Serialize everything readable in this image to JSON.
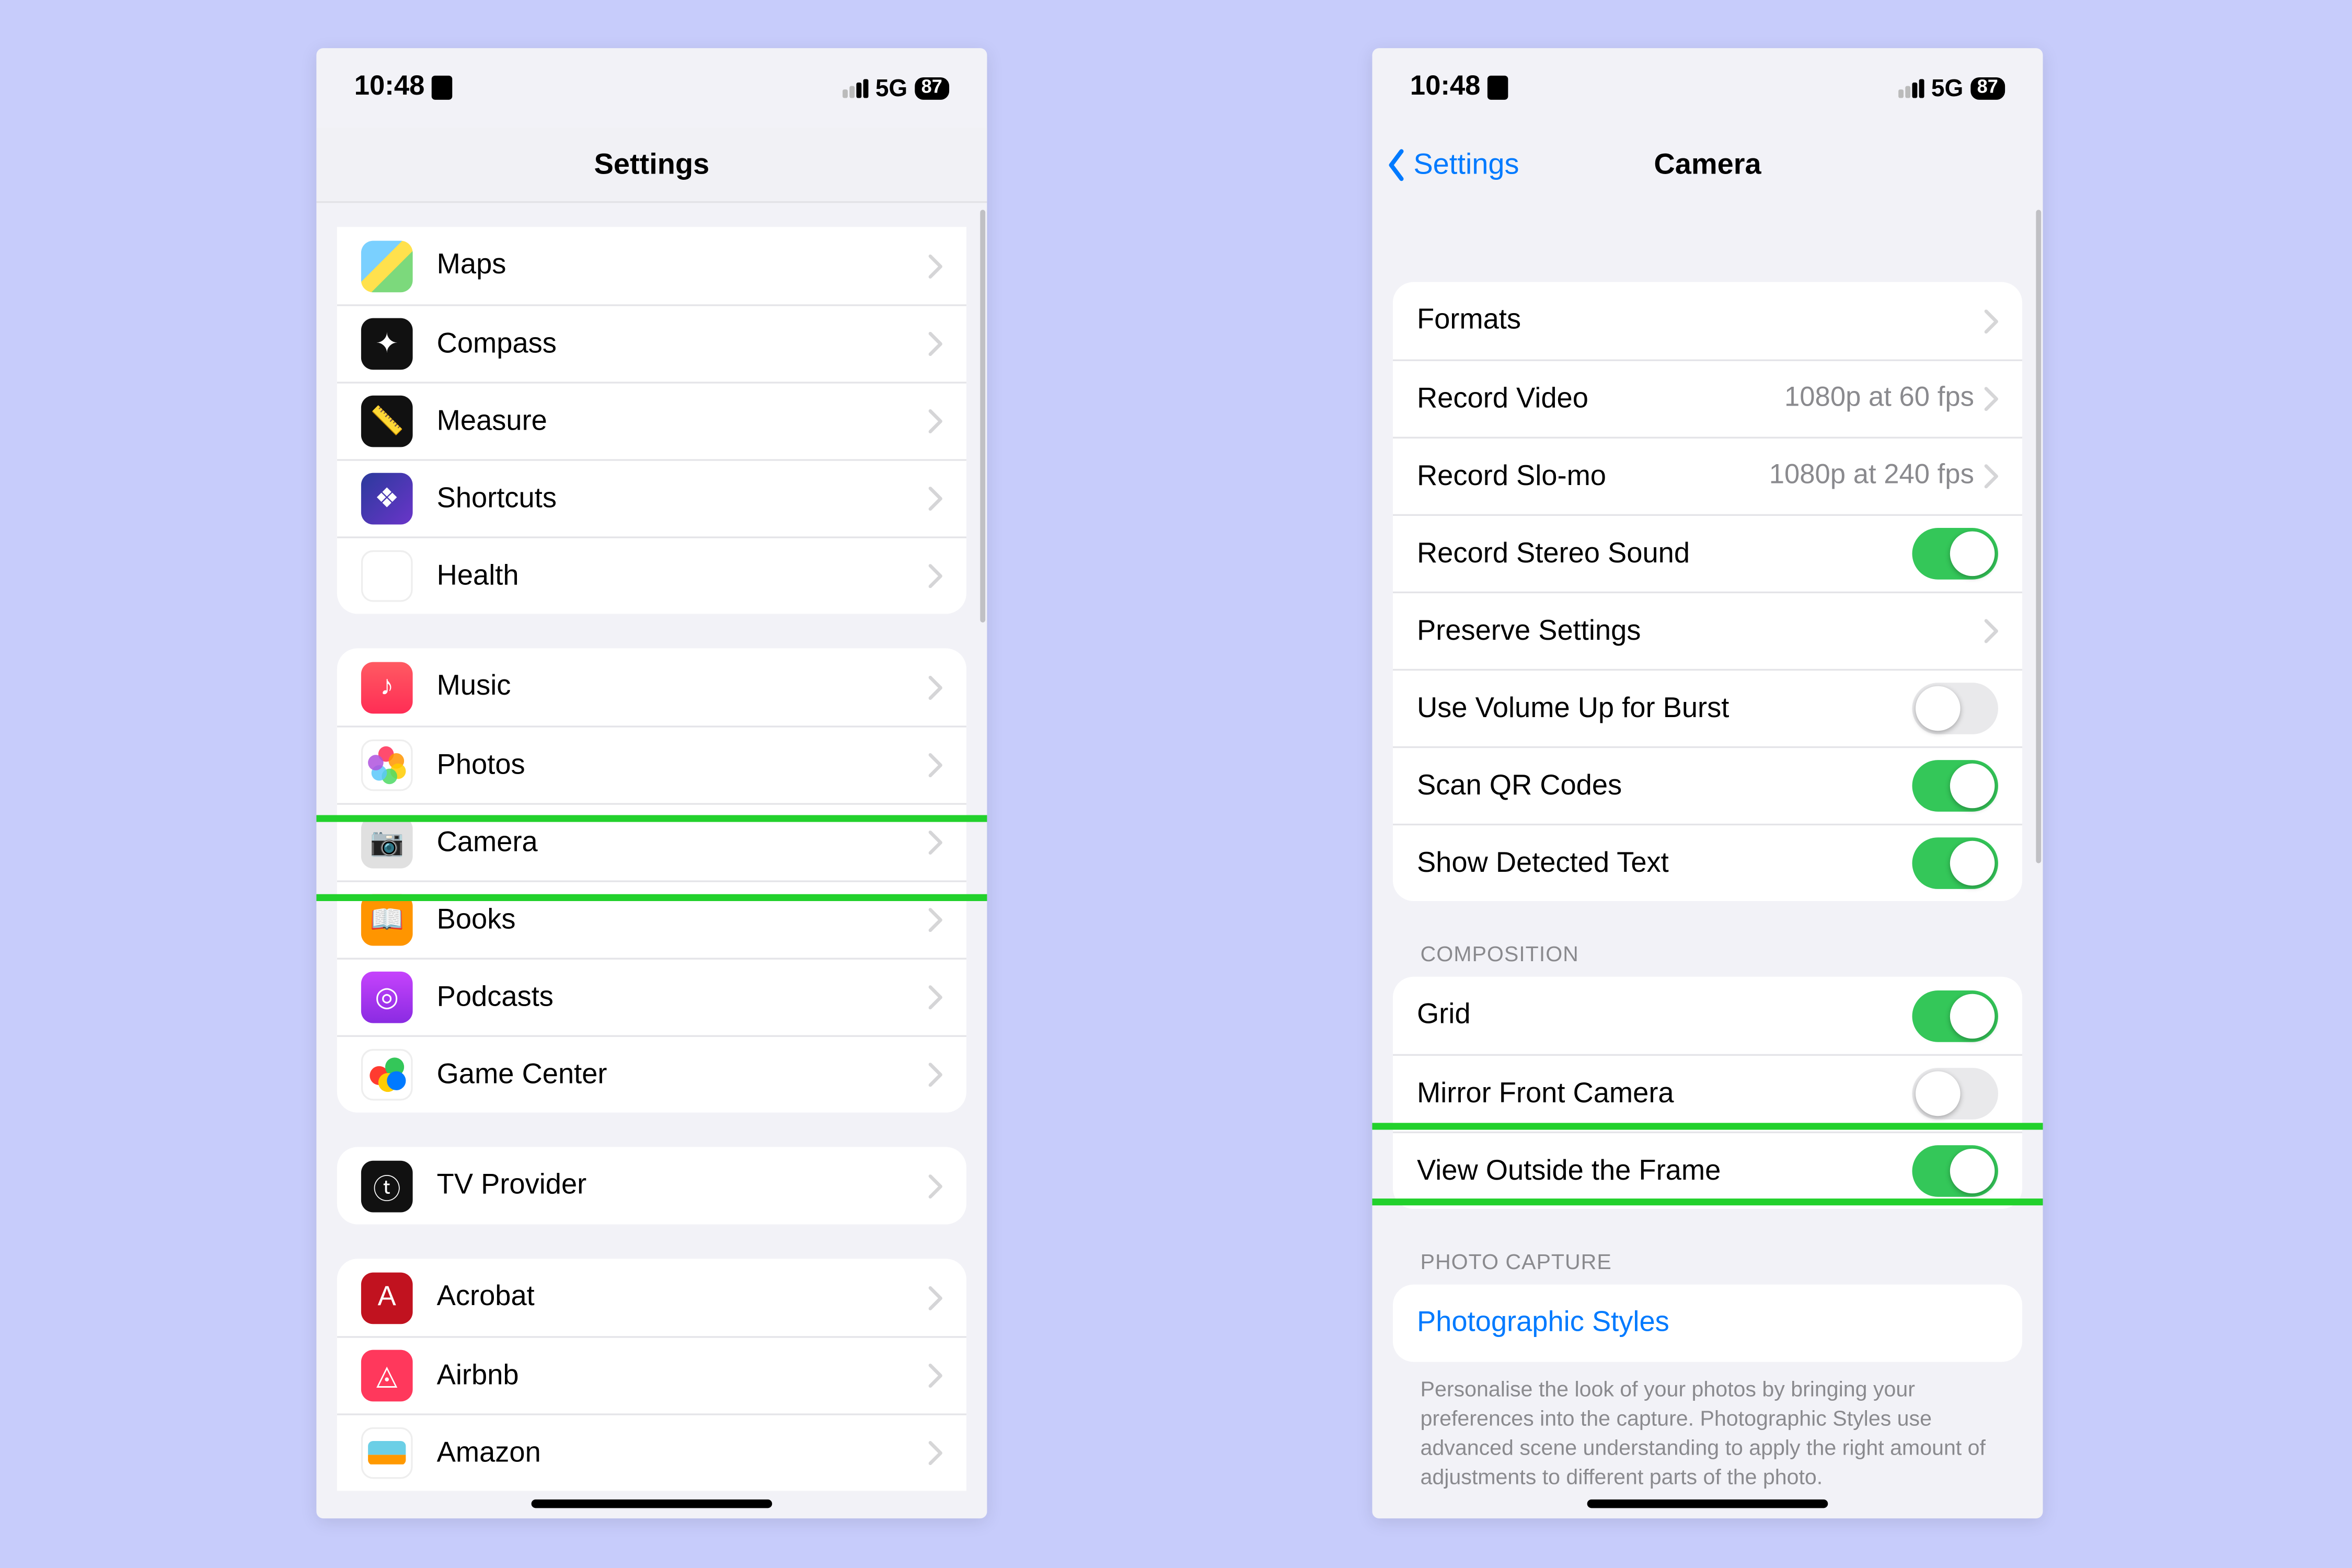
{
  "status": {
    "time": "10:48",
    "network": "5G",
    "battery": "87"
  },
  "left": {
    "title": "Settings",
    "g1": [
      {
        "name": "maps",
        "label": "Maps",
        "iconClass": "ic-maps",
        "glyph": ""
      },
      {
        "name": "compass",
        "label": "Compass",
        "iconClass": "ic-compass",
        "glyph": "✦"
      },
      {
        "name": "measure",
        "label": "Measure",
        "iconClass": "ic-measure",
        "glyph": "📏"
      },
      {
        "name": "shortcuts",
        "label": "Shortcuts",
        "iconClass": "ic-shortcuts",
        "glyph": "❖"
      },
      {
        "name": "health",
        "label": "Health",
        "iconClass": "ic-health",
        "glyph": "♥"
      }
    ],
    "g2": [
      {
        "name": "music",
        "label": "Music",
        "iconClass": "ic-music",
        "glyph": "♪"
      },
      {
        "name": "photos",
        "label": "Photos",
        "iconClass": "ic-photos",
        "glyph": ""
      },
      {
        "name": "camera",
        "label": "Camera",
        "iconClass": "ic-camera",
        "glyph": "📷"
      },
      {
        "name": "books",
        "label": "Books",
        "iconClass": "ic-books",
        "glyph": "📖"
      },
      {
        "name": "podcasts",
        "label": "Podcasts",
        "iconClass": "ic-podcasts",
        "glyph": "◎"
      },
      {
        "name": "game-center",
        "label": "Game Center",
        "iconClass": "ic-gamecenter",
        "glyph": ""
      }
    ],
    "g3": [
      {
        "name": "tv-provider",
        "label": "TV Provider",
        "iconClass": "ic-tv",
        "glyph": "ⓣ"
      }
    ],
    "g4": [
      {
        "name": "acrobat",
        "label": "Acrobat",
        "iconClass": "ic-acrobat",
        "glyph": "A"
      },
      {
        "name": "airbnb",
        "label": "Airbnb",
        "iconClass": "ic-airbnb",
        "glyph": "◬"
      },
      {
        "name": "amazon",
        "label": "Amazon",
        "iconClass": "ic-amazon",
        "glyph": ""
      }
    ]
  },
  "right": {
    "back": "Settings",
    "title": "Camera",
    "g1": [
      {
        "name": "formats",
        "label": "Formats",
        "type": "disclosure"
      },
      {
        "name": "record-video",
        "label": "Record Video",
        "type": "disclosure",
        "detail": "1080p at 60 fps"
      },
      {
        "name": "record-slomo",
        "label": "Record Slo-mo",
        "type": "disclosure",
        "detail": "1080p at 240 fps"
      },
      {
        "name": "record-stereo",
        "label": "Record Stereo Sound",
        "type": "toggle",
        "on": true
      },
      {
        "name": "preserve-settings",
        "label": "Preserve Settings",
        "type": "disclosure"
      },
      {
        "name": "volume-burst",
        "label": "Use Volume Up for Burst",
        "type": "toggle",
        "on": false
      },
      {
        "name": "scan-qr",
        "label": "Scan QR Codes",
        "type": "toggle",
        "on": true
      },
      {
        "name": "detected-text",
        "label": "Show Detected Text",
        "type": "toggle",
        "on": true
      }
    ],
    "h2": "Composition",
    "g2": [
      {
        "name": "grid",
        "label": "Grid",
        "type": "toggle",
        "on": true
      },
      {
        "name": "mirror-front",
        "label": "Mirror Front Camera",
        "type": "toggle",
        "on": false
      },
      {
        "name": "view-outside",
        "label": "View Outside the Frame",
        "type": "toggle",
        "on": true
      }
    ],
    "h3": "Photo Capture",
    "g3": [
      {
        "name": "photographic-styles",
        "label": "Photographic Styles",
        "type": "link"
      }
    ],
    "f3": "Personalise the look of your photos by bringing your preferences into the capture. Photographic Styles use advanced scene understanding to apply the right amount of adjustments to different parts of the photo."
  }
}
